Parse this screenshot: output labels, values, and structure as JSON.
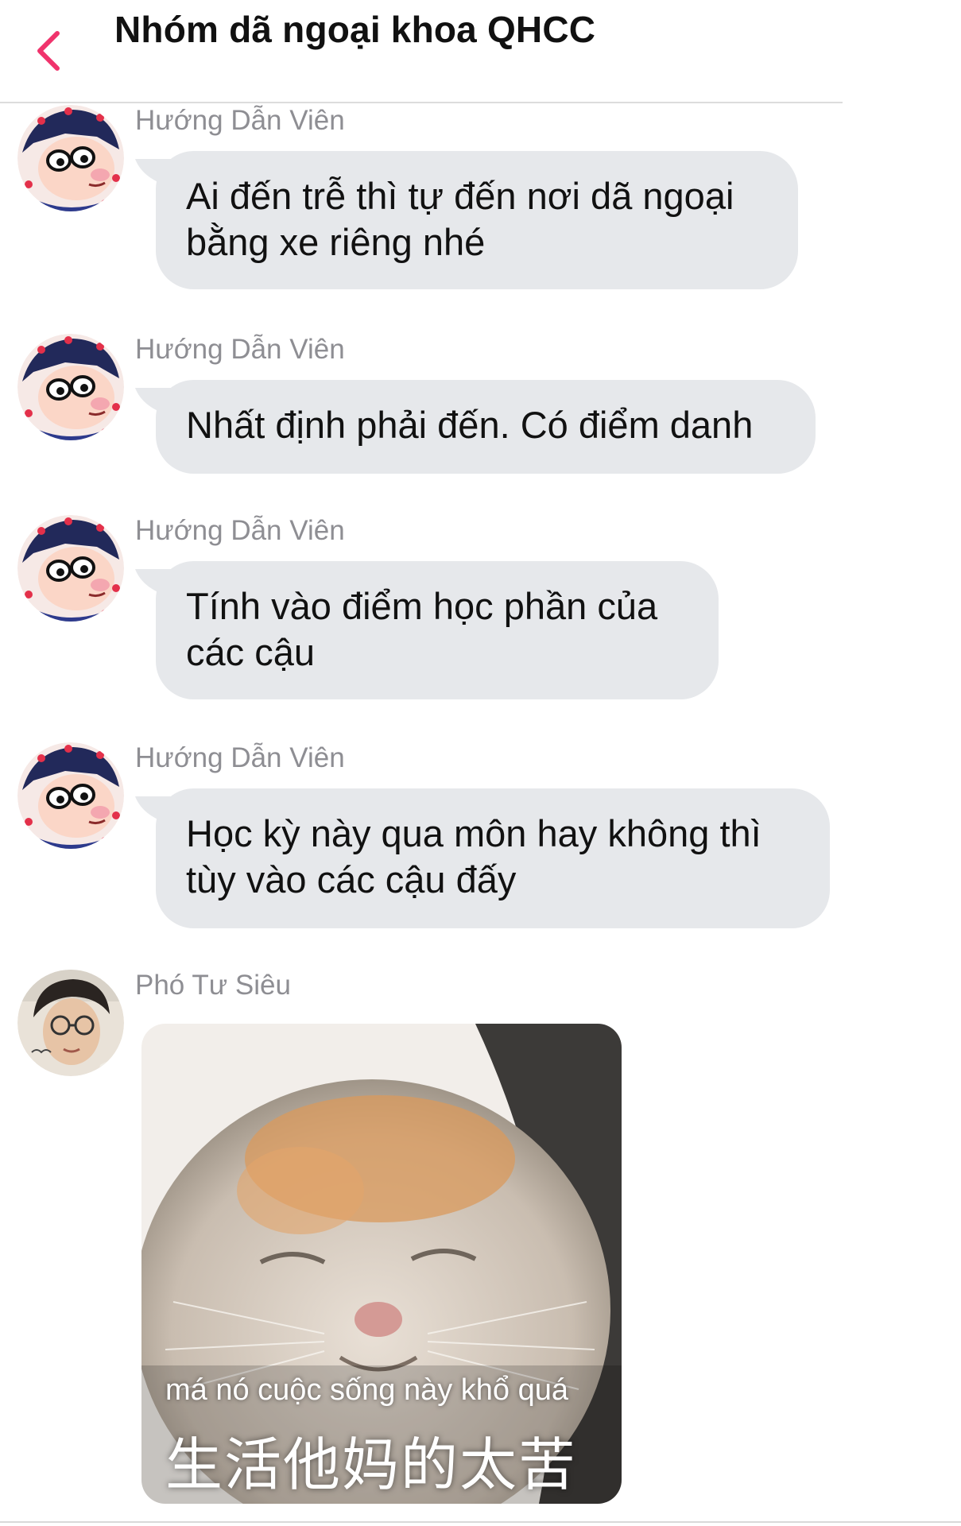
{
  "header": {
    "title": "Nhóm dã ngoại khoa QHCC",
    "back_icon": "chevron-left-icon",
    "accent_color": "#f0336c"
  },
  "messages": [
    {
      "sender": "Hướng Dẫn Viên",
      "avatar": "cartoon-boy-avatar",
      "text": "Ai đến trễ thì tự đến nơi dã ngoại\nbằng xe riêng nhé"
    },
    {
      "sender": "Hướng Dẫn Viên",
      "avatar": "cartoon-boy-avatar",
      "text": "Nhất định phải đến. Có điểm danh"
    },
    {
      "sender": "Hướng Dẫn Viên",
      "avatar": "cartoon-boy-avatar",
      "text": "Tính vào điểm học phần của\ncác cậu"
    },
    {
      "sender": "Hướng Dẫn Viên",
      "avatar": "cartoon-boy-avatar",
      "text": "Học kỳ này qua môn hay không thì\ntùy vào các cậu đấy"
    },
    {
      "sender": "Phó Tư Siêu",
      "avatar": "photo-person-avatar",
      "sticker": {
        "caption": "má nó cuộc sống này khổ quá",
        "caption_cn": "生活他妈的太苦"
      }
    }
  ],
  "colors": {
    "bubble": "#e6e8eb",
    "sender_name": "#8e8e93"
  }
}
